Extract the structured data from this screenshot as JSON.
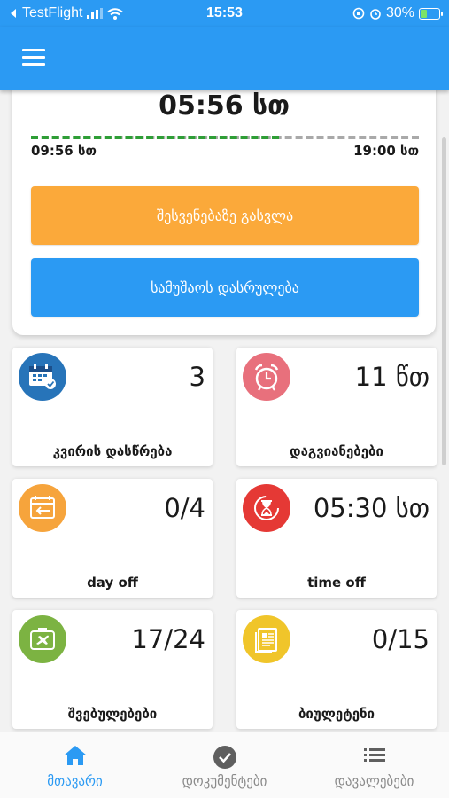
{
  "status_bar": {
    "carrier": "TestFlight",
    "time": "15:53",
    "battery": "30%",
    "battery_level": 0.3
  },
  "timer": {
    "current": "05:56 სთ",
    "start": "09:56 სთ",
    "end": "19:00 სთ",
    "progress": 0.64
  },
  "actions": {
    "break_label": "შესვენებაზე გასვლა",
    "finish_label": "სამუშაოს დასრულება"
  },
  "tiles": [
    {
      "value": "3",
      "label": "კვირის დასწრება",
      "icon": "calendar-check-icon",
      "color": "#2774b9"
    },
    {
      "value": "11 წთ",
      "label": "დაგვიანებები",
      "icon": "alarm-clock-icon",
      "color": "#e8707c"
    },
    {
      "value": "0/4",
      "label": "day off",
      "icon": "calendar-arrow-icon",
      "color": "#f6a43c"
    },
    {
      "value": "05:30 სთ",
      "label": "time off",
      "icon": "hourglass-icon",
      "color": "#e53935"
    },
    {
      "value": "17/24",
      "label": "შვებულებები",
      "icon": "suitcase-plane-icon",
      "color": "#7cb342"
    },
    {
      "value": "0/15",
      "label": "ბიულეტენი",
      "icon": "document-icon",
      "color": "#f0c52a"
    }
  ],
  "tabs": [
    {
      "label": "მთავარი",
      "icon": "home-icon"
    },
    {
      "label": "დოკუმენტები",
      "icon": "check-circle-icon"
    },
    {
      "label": "დავალებები",
      "icon": "list-icon"
    }
  ],
  "colors": {
    "primary": "#2b9af3",
    "break_button": "#fba93a",
    "progress_done": "#2e9e36",
    "progress_remaining": "#a9a9a9"
  }
}
